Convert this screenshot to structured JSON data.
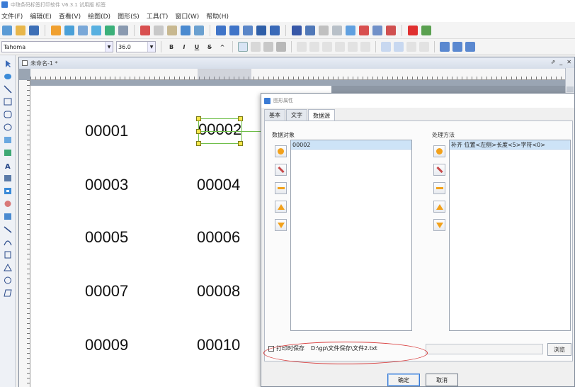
{
  "app": {
    "title": "中琅条码标签打印软件  V6.3.1  试用版  标签"
  },
  "menu": [
    "文件(F)",
    "编辑(E)",
    "查看(V)",
    "绘图(D)",
    "图形(S)",
    "工具(T)",
    "窗口(W)",
    "帮助(H)"
  ],
  "format": {
    "font": "Tahoma",
    "size": "36.0"
  },
  "document": {
    "title": "未命名-1 *"
  },
  "labels": [
    "00001",
    "00002",
    "00003",
    "00004",
    "00005",
    "00006",
    "00007",
    "00008",
    "00009",
    "00010"
  ],
  "dialog": {
    "title": "图形属性",
    "tabs": [
      "基本",
      "文字",
      "数据源"
    ],
    "data_objects_label": "数据对象",
    "data_objects": [
      "00002"
    ],
    "process_label": "处理方法",
    "process_methods": [
      "补齐 位置<左侧>长度<5>字符<0>"
    ],
    "save_checkbox_label": "打印时保存",
    "save_path": "D:\\gp\\文件保存\\文件2.txt",
    "browse_label": "浏览",
    "ok_label": "确定",
    "cancel_label": "取消"
  },
  "colors": {
    "selection": "#6fbf4a",
    "annotation": "#d83a3a",
    "list_highlight": "#cde3f7"
  }
}
